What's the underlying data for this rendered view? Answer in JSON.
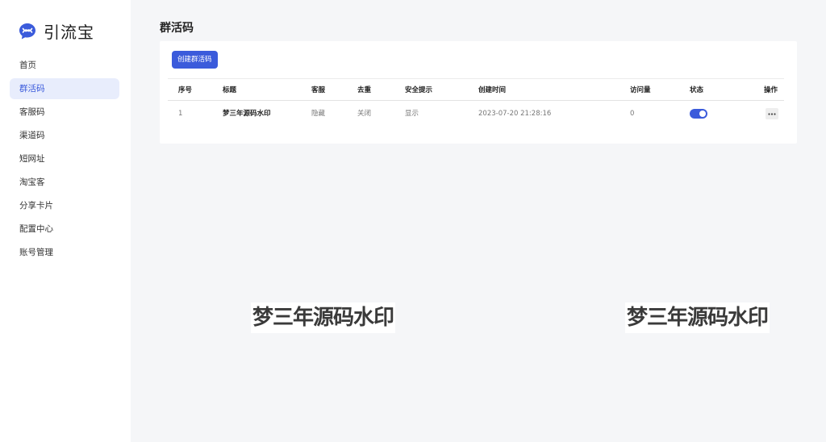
{
  "brand": {
    "name": "引流宝",
    "accent_color": "#3b5bdb"
  },
  "sidebar": {
    "items": [
      {
        "label": "首页",
        "active": false
      },
      {
        "label": "群活码",
        "active": true
      },
      {
        "label": "客服码",
        "active": false
      },
      {
        "label": "渠道码",
        "active": false
      },
      {
        "label": "短网址",
        "active": false
      },
      {
        "label": "淘宝客",
        "active": false
      },
      {
        "label": "分享卡片",
        "active": false
      },
      {
        "label": "配置中心",
        "active": false
      },
      {
        "label": "账号管理",
        "active": false
      }
    ]
  },
  "main": {
    "page_title": "群活码",
    "create_button_label": "创建群活码",
    "table": {
      "columns": [
        "序号",
        "标题",
        "客服",
        "去重",
        "安全提示",
        "创建时间",
        "访问量",
        "状态",
        "操作"
      ],
      "rows": [
        {
          "index": "1",
          "title": "梦三年源码水印",
          "customer_service": "隐藏",
          "dedup": "关闭",
          "safety_tip": "显示",
          "created_at": "2023-07-20 21:28:16",
          "visits": "0",
          "status_on": true,
          "ops_icon": "more-horizontal-icon"
        }
      ]
    }
  },
  "watermarks": [
    "梦三年源码水印",
    "梦三年源码水印"
  ]
}
